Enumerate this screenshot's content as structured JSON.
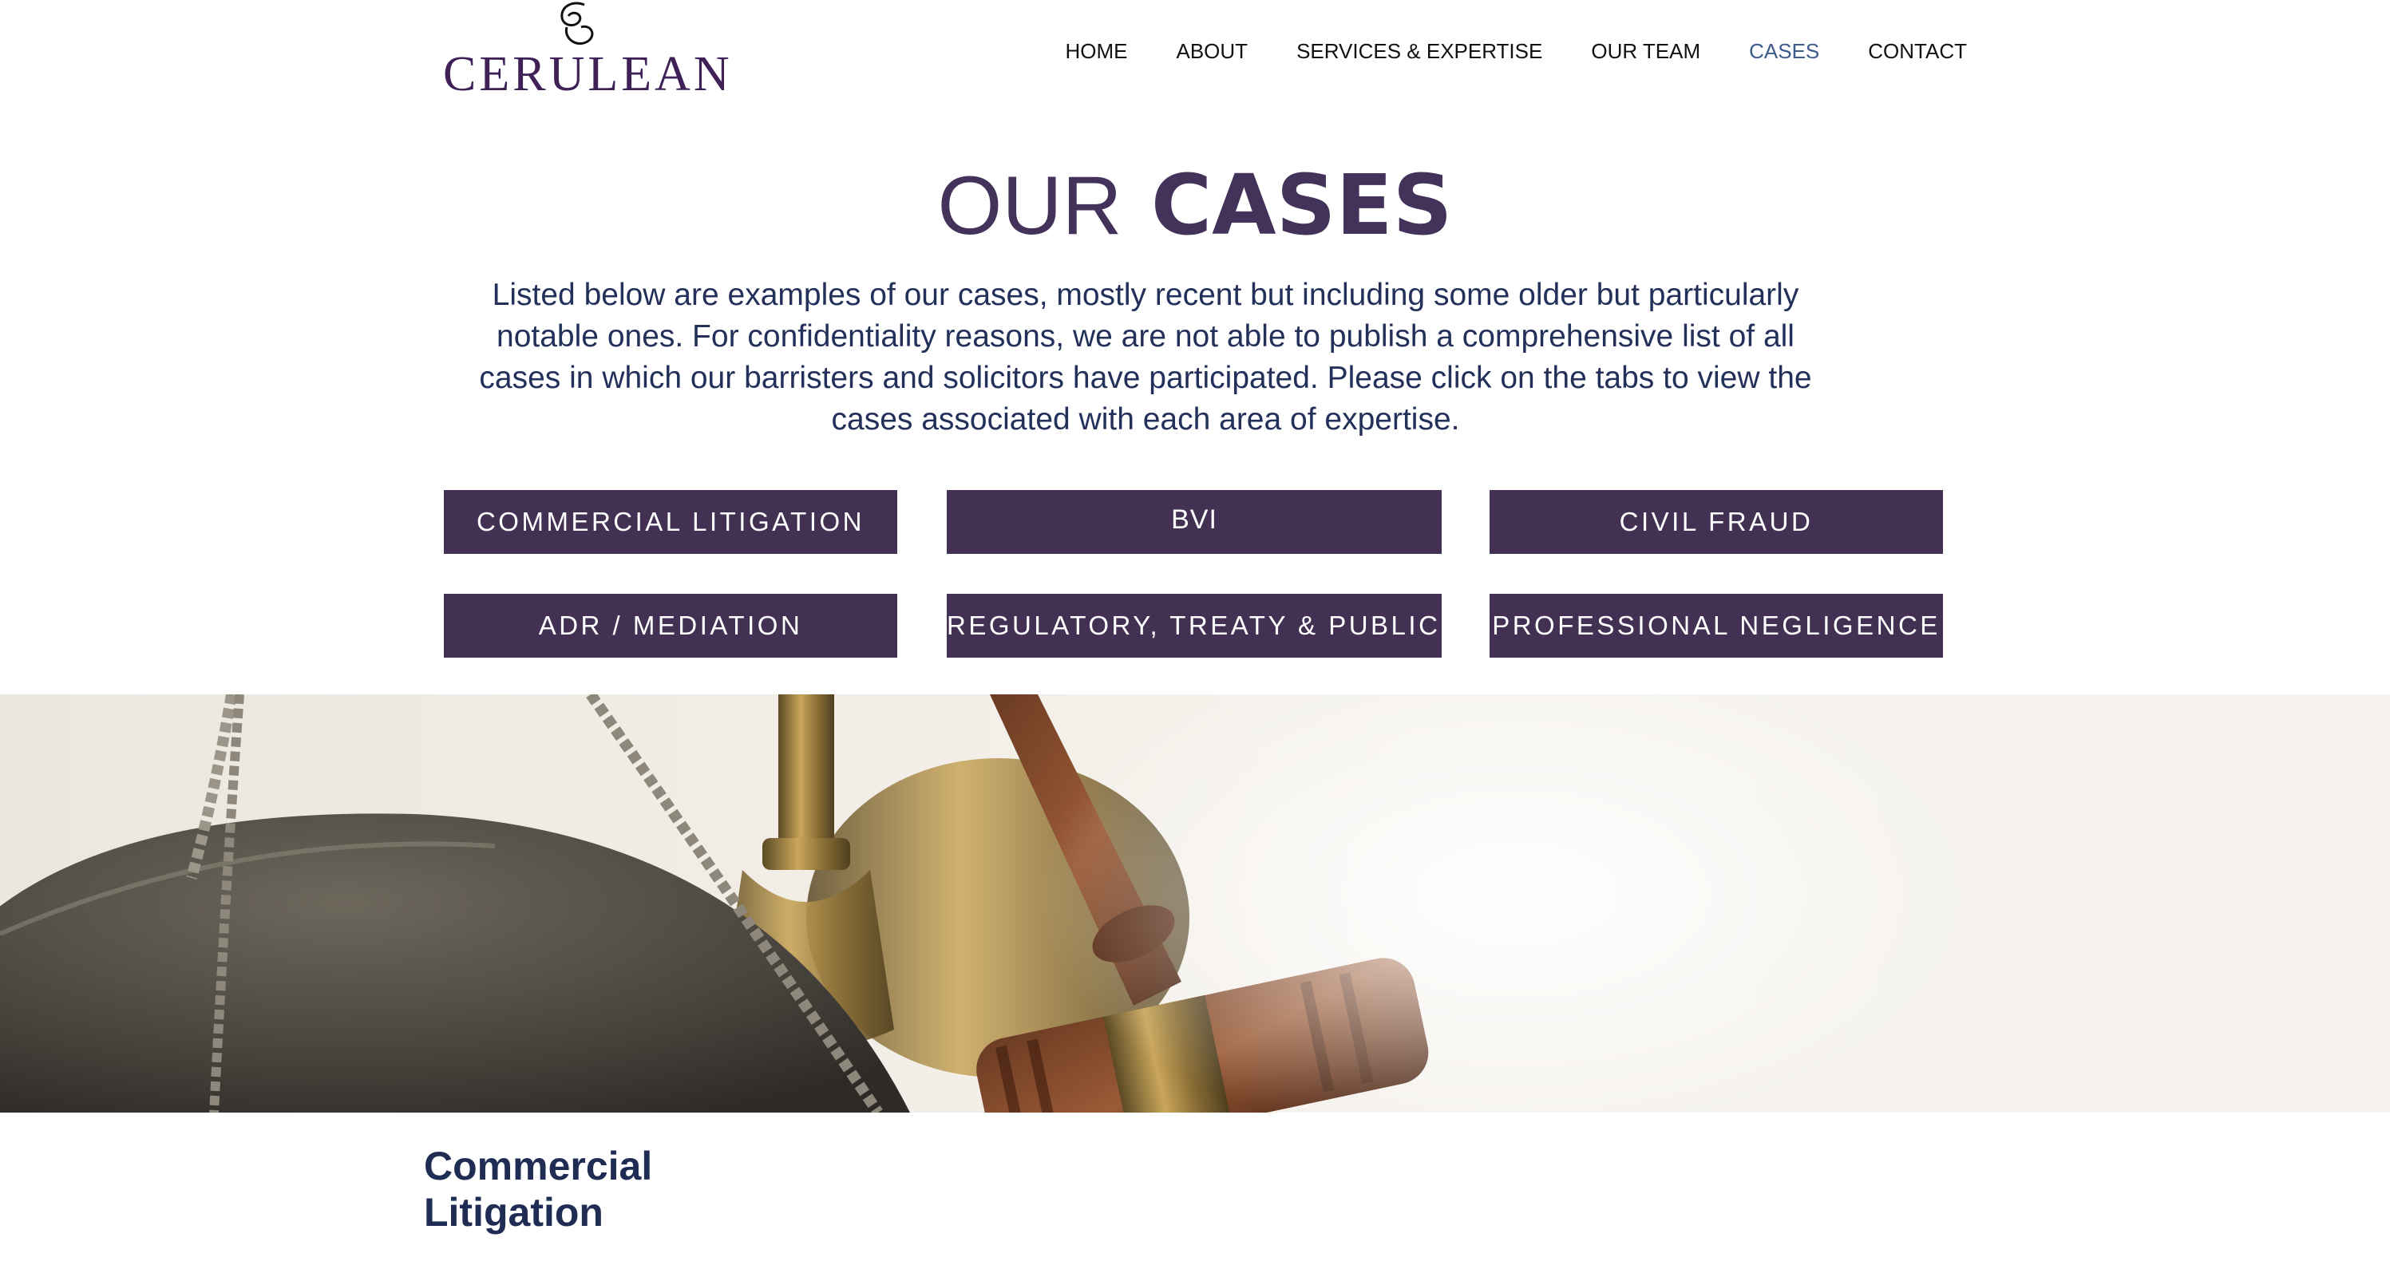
{
  "brand": {
    "name": "CERULEAN"
  },
  "nav": {
    "items": [
      {
        "label": "HOME"
      },
      {
        "label": "ABOUT"
      },
      {
        "label": "SERVICES & EXPERTISE"
      },
      {
        "label": "OUR TEAM"
      },
      {
        "label": "CASES"
      },
      {
        "label": "CONTACT"
      }
    ],
    "active": "CASES",
    "active_color": "#3c5a8c"
  },
  "page": {
    "title_light": "OUR",
    "title_bold": "CASES",
    "intro": "Listed below are examples of our cases, mostly recent but including some older but particularly notable ones. For confidentiality reasons, we are not able to publish a comprehensive list of all cases in which our barristers and solicitors have participated. Please click on the tabs to view the cases associated with each area of expertise."
  },
  "tabs": [
    {
      "label": "COMMERCIAL LITIGATION"
    },
    {
      "label": "BVI"
    },
    {
      "label": "CIVIL FRAUD"
    },
    {
      "label": "ADR / MEDIATION"
    },
    {
      "label": "REGULATORY, TREATY & PUBLIC..."
    },
    {
      "label": "PROFESSIONAL NEGLIGENCE"
    }
  ],
  "colors": {
    "brand_purple": "#433153",
    "text_navy": "#22305a"
  },
  "section": {
    "heading": "Commercial Litigation"
  }
}
